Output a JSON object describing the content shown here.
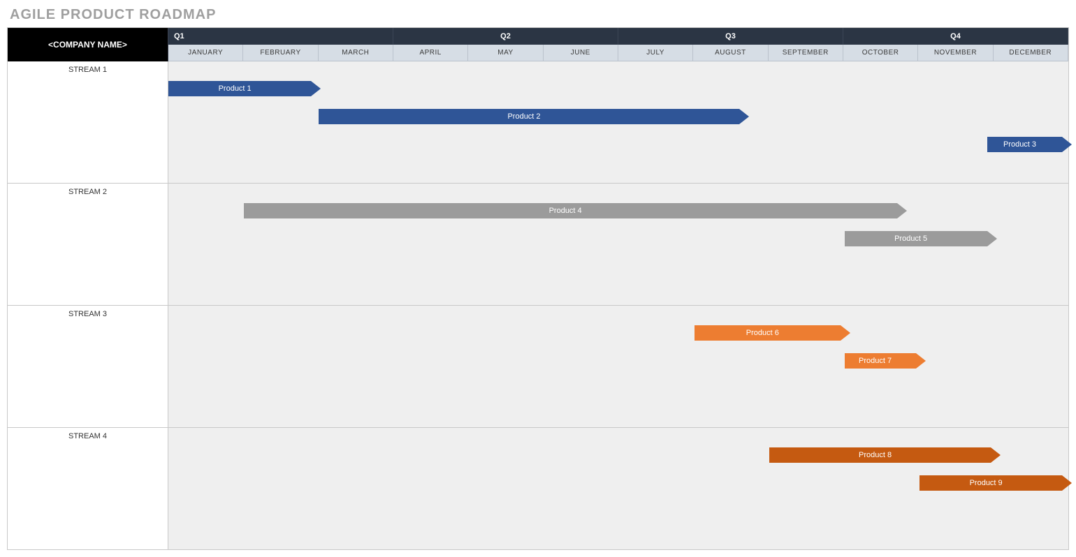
{
  "title": "AGILE PRODUCT ROADMAP",
  "company_placeholder": "<COMPANY NAME>",
  "quarters": [
    "Q1",
    "Q2",
    "Q3",
    "Q4"
  ],
  "months": [
    "JANUARY",
    "FEBRUARY",
    "MARCH",
    "APRIL",
    "MAY",
    "JUNE",
    "JULY",
    "AUGUST",
    "SEPTEMBER",
    "OCTOBER",
    "NOVEMBER",
    "DECEMBER"
  ],
  "colors": {
    "blue": "#2f5597",
    "gray": "#9b9b9b",
    "orange": "#ed7d31",
    "dorange": "#c55a11"
  },
  "streams": [
    {
      "name": "STREAM 1",
      "bars": [
        {
          "label": "Product 1",
          "start_month": 1,
          "end_month": 2.9,
          "color": "blue"
        },
        {
          "label": "Product 2",
          "start_month": 3,
          "end_month": 8.6,
          "color": "blue"
        },
        {
          "label": "Product  3",
          "start_month": 11.9,
          "end_month": 12.9,
          "color": "blue"
        }
      ]
    },
    {
      "name": "STREAM 2",
      "bars": [
        {
          "label": "Product 4",
          "start_month": 2,
          "end_month": 10.7,
          "color": "gray"
        },
        {
          "label": "Product 5",
          "start_month": 10,
          "end_month": 11.9,
          "color": "gray"
        }
      ]
    },
    {
      "name": "STREAM 3",
      "bars": [
        {
          "label": "Product 6",
          "start_month": 8,
          "end_month": 9.95,
          "color": "orange"
        },
        {
          "label": "Product 7",
          "start_month": 10,
          "end_month": 10.95,
          "color": "orange"
        }
      ]
    },
    {
      "name": "STREAM 4",
      "bars": [
        {
          "label": "Product 8",
          "start_month": 9,
          "end_month": 11.95,
          "color": "dorange"
        },
        {
          "label": "Product 9",
          "start_month": 11,
          "end_month": 12.9,
          "color": "dorange"
        }
      ]
    }
  ],
  "chart_data": {
    "type": "gantt",
    "title": "AGILE PRODUCT ROADMAP",
    "x_categories": [
      "JANUARY",
      "FEBRUARY",
      "MARCH",
      "APRIL",
      "MAY",
      "JUNE",
      "JULY",
      "AUGUST",
      "SEPTEMBER",
      "OCTOBER",
      "NOVEMBER",
      "DECEMBER"
    ],
    "x_groups": [
      {
        "label": "Q1",
        "span": [
          "JANUARY",
          "MARCH"
        ]
      },
      {
        "label": "Q2",
        "span": [
          "APRIL",
          "JUNE"
        ]
      },
      {
        "label": "Q3",
        "span": [
          "JULY",
          "SEPTEMBER"
        ]
      },
      {
        "label": "Q4",
        "span": [
          "OCTOBER",
          "DECEMBER"
        ]
      }
    ],
    "series": [
      {
        "group": "STREAM 1",
        "name": "Product 1",
        "start": "JANUARY",
        "end": "FEBRUARY",
        "color": "#2f5597"
      },
      {
        "group": "STREAM 1",
        "name": "Product 2",
        "start": "MARCH",
        "end": "AUGUST",
        "color": "#2f5597"
      },
      {
        "group": "STREAM 1",
        "name": "Product 3",
        "start": "DECEMBER",
        "end": "DECEMBER",
        "color": "#2f5597"
      },
      {
        "group": "STREAM 2",
        "name": "Product 4",
        "start": "FEBRUARY",
        "end": "OCTOBER",
        "color": "#9b9b9b"
      },
      {
        "group": "STREAM 2",
        "name": "Product 5",
        "start": "OCTOBER",
        "end": "NOVEMBER",
        "color": "#9b9b9b"
      },
      {
        "group": "STREAM 3",
        "name": "Product 6",
        "start": "AUGUST",
        "end": "SEPTEMBER",
        "color": "#ed7d31"
      },
      {
        "group": "STREAM 3",
        "name": "Product 7",
        "start": "OCTOBER",
        "end": "OCTOBER",
        "color": "#ed7d31"
      },
      {
        "group": "STREAM 4",
        "name": "Product 8",
        "start": "SEPTEMBER",
        "end": "NOVEMBER",
        "color": "#c55a11"
      },
      {
        "group": "STREAM 4",
        "name": "Product 9",
        "start": "NOVEMBER",
        "end": "DECEMBER",
        "color": "#c55a11"
      }
    ]
  }
}
